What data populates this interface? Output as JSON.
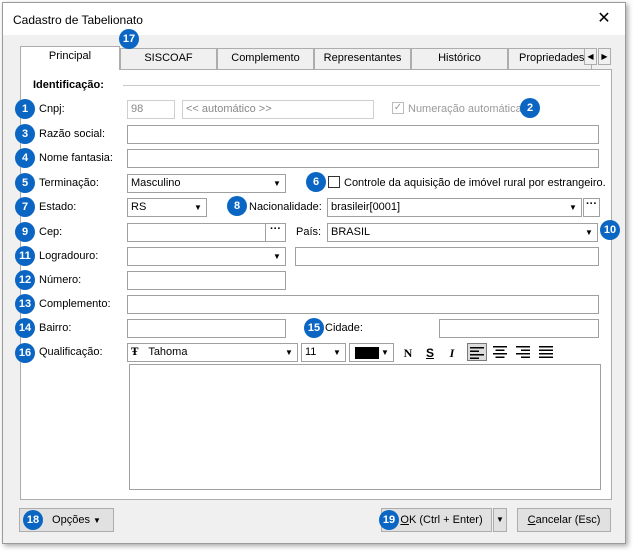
{
  "window": {
    "title": "Cadastro de Tabelionato",
    "close_symbol": "✕"
  },
  "tabs": [
    {
      "label": "Principal"
    },
    {
      "label": "SISCOAF"
    },
    {
      "label": "Complemento"
    },
    {
      "label": "Representantes"
    },
    {
      "label": "Histórico"
    },
    {
      "label": "Propriedades"
    }
  ],
  "tab_scroll": {
    "left": "◀",
    "right": "▶"
  },
  "section": {
    "title": "Identificação:"
  },
  "badges": [
    "1",
    "2",
    "3",
    "4",
    "5",
    "6",
    "7",
    "8",
    "9",
    "10",
    "11",
    "12",
    "13",
    "14",
    "15",
    "16",
    "17",
    "18",
    "19"
  ],
  "cnpj": {
    "label": "Cnpj:",
    "code_value": "98",
    "auto_placeholder": "<< automático >>"
  },
  "auto_numbering": {
    "label": "Numeração automática",
    "checked": true,
    "check_mark": "✓"
  },
  "razao_social": {
    "label": "Razão social:",
    "value": ""
  },
  "nome_fantasia": {
    "label": "Nome fantasia:",
    "value": ""
  },
  "terminacao": {
    "label": "Terminação:",
    "value": "Masculino"
  },
  "controle": {
    "label": "Controle da aquisição de imóvel rural por estrangeiro.",
    "checked": false
  },
  "estado": {
    "label": "Estado:",
    "value": "RS"
  },
  "nacionalidade": {
    "label": "Nacionalidade:",
    "value": "brasileir[0001]"
  },
  "cep": {
    "label": "Cep:",
    "value": ""
  },
  "pais": {
    "label": "País:",
    "value": "BRASIL"
  },
  "logradouro": {
    "label": "Logradouro:",
    "value": ""
  },
  "numero": {
    "label": "Número:",
    "value": ""
  },
  "complemento": {
    "label": "Complemento:",
    "value": ""
  },
  "bairro": {
    "label": "Bairro:",
    "value": ""
  },
  "cidade": {
    "label": "Cidade:",
    "value": ""
  },
  "qualificacao": {
    "label": "Qualificação:",
    "font_name": "Tahoma",
    "font_icon_glyph": "Ŧ",
    "font_size": "11",
    "text_color": "#000000",
    "bold_glyph": "N",
    "underline_glyph": "S",
    "italic_glyph": "I"
  },
  "ellipsis": "···",
  "dropdown_glyph": "▼",
  "buttons": {
    "opcoes": "Opções",
    "ok_underlined": "O",
    "ok_rest": "K (Ctrl + Enter)",
    "cancel_underlined": "C",
    "cancel_rest": "ancelar (Esc)"
  }
}
